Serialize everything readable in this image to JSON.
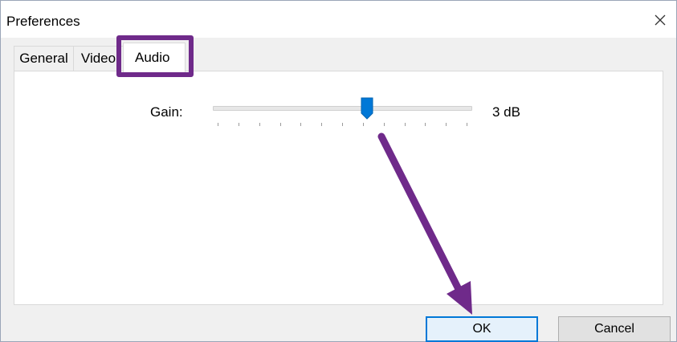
{
  "window": {
    "title": "Preferences",
    "close_icon": "close-icon"
  },
  "tabs": [
    {
      "label": "General",
      "selected": false
    },
    {
      "label": "Video",
      "selected": false
    },
    {
      "label": "Audio",
      "selected": true
    }
  ],
  "audio": {
    "gain_label": "Gain:",
    "gain_value_text": "3 dB",
    "slider_position": 0.6,
    "tick_count": 13
  },
  "buttons": {
    "ok_label": "OK",
    "cancel_label": "Cancel"
  },
  "colors": {
    "highlight": "#6f2a8a",
    "accent": "#0078d7"
  }
}
